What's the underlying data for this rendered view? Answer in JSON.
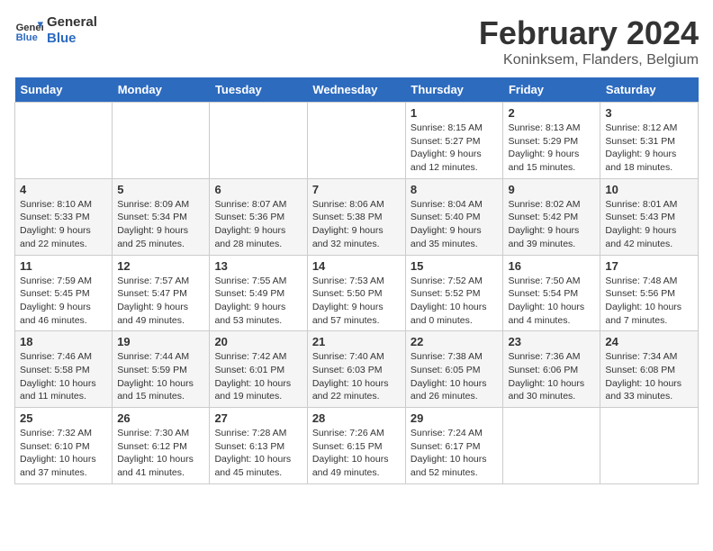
{
  "header": {
    "logo_line1": "General",
    "logo_line2": "Blue",
    "month": "February 2024",
    "location": "Koninksem, Flanders, Belgium"
  },
  "days_of_week": [
    "Sunday",
    "Monday",
    "Tuesday",
    "Wednesday",
    "Thursday",
    "Friday",
    "Saturday"
  ],
  "weeks": [
    [
      {
        "day": "",
        "info": ""
      },
      {
        "day": "",
        "info": ""
      },
      {
        "day": "",
        "info": ""
      },
      {
        "day": "",
        "info": ""
      },
      {
        "day": "1",
        "info": "Sunrise: 8:15 AM\nSunset: 5:27 PM\nDaylight: 9 hours\nand 12 minutes."
      },
      {
        "day": "2",
        "info": "Sunrise: 8:13 AM\nSunset: 5:29 PM\nDaylight: 9 hours\nand 15 minutes."
      },
      {
        "day": "3",
        "info": "Sunrise: 8:12 AM\nSunset: 5:31 PM\nDaylight: 9 hours\nand 18 minutes."
      }
    ],
    [
      {
        "day": "4",
        "info": "Sunrise: 8:10 AM\nSunset: 5:33 PM\nDaylight: 9 hours\nand 22 minutes."
      },
      {
        "day": "5",
        "info": "Sunrise: 8:09 AM\nSunset: 5:34 PM\nDaylight: 9 hours\nand 25 minutes."
      },
      {
        "day": "6",
        "info": "Sunrise: 8:07 AM\nSunset: 5:36 PM\nDaylight: 9 hours\nand 28 minutes."
      },
      {
        "day": "7",
        "info": "Sunrise: 8:06 AM\nSunset: 5:38 PM\nDaylight: 9 hours\nand 32 minutes."
      },
      {
        "day": "8",
        "info": "Sunrise: 8:04 AM\nSunset: 5:40 PM\nDaylight: 9 hours\nand 35 minutes."
      },
      {
        "day": "9",
        "info": "Sunrise: 8:02 AM\nSunset: 5:42 PM\nDaylight: 9 hours\nand 39 minutes."
      },
      {
        "day": "10",
        "info": "Sunrise: 8:01 AM\nSunset: 5:43 PM\nDaylight: 9 hours\nand 42 minutes."
      }
    ],
    [
      {
        "day": "11",
        "info": "Sunrise: 7:59 AM\nSunset: 5:45 PM\nDaylight: 9 hours\nand 46 minutes."
      },
      {
        "day": "12",
        "info": "Sunrise: 7:57 AM\nSunset: 5:47 PM\nDaylight: 9 hours\nand 49 minutes."
      },
      {
        "day": "13",
        "info": "Sunrise: 7:55 AM\nSunset: 5:49 PM\nDaylight: 9 hours\nand 53 minutes."
      },
      {
        "day": "14",
        "info": "Sunrise: 7:53 AM\nSunset: 5:50 PM\nDaylight: 9 hours\nand 57 minutes."
      },
      {
        "day": "15",
        "info": "Sunrise: 7:52 AM\nSunset: 5:52 PM\nDaylight: 10 hours\nand 0 minutes."
      },
      {
        "day": "16",
        "info": "Sunrise: 7:50 AM\nSunset: 5:54 PM\nDaylight: 10 hours\nand 4 minutes."
      },
      {
        "day": "17",
        "info": "Sunrise: 7:48 AM\nSunset: 5:56 PM\nDaylight: 10 hours\nand 7 minutes."
      }
    ],
    [
      {
        "day": "18",
        "info": "Sunrise: 7:46 AM\nSunset: 5:58 PM\nDaylight: 10 hours\nand 11 minutes."
      },
      {
        "day": "19",
        "info": "Sunrise: 7:44 AM\nSunset: 5:59 PM\nDaylight: 10 hours\nand 15 minutes."
      },
      {
        "day": "20",
        "info": "Sunrise: 7:42 AM\nSunset: 6:01 PM\nDaylight: 10 hours\nand 19 minutes."
      },
      {
        "day": "21",
        "info": "Sunrise: 7:40 AM\nSunset: 6:03 PM\nDaylight: 10 hours\nand 22 minutes."
      },
      {
        "day": "22",
        "info": "Sunrise: 7:38 AM\nSunset: 6:05 PM\nDaylight: 10 hours\nand 26 minutes."
      },
      {
        "day": "23",
        "info": "Sunrise: 7:36 AM\nSunset: 6:06 PM\nDaylight: 10 hours\nand 30 minutes."
      },
      {
        "day": "24",
        "info": "Sunrise: 7:34 AM\nSunset: 6:08 PM\nDaylight: 10 hours\nand 33 minutes."
      }
    ],
    [
      {
        "day": "25",
        "info": "Sunrise: 7:32 AM\nSunset: 6:10 PM\nDaylight: 10 hours\nand 37 minutes."
      },
      {
        "day": "26",
        "info": "Sunrise: 7:30 AM\nSunset: 6:12 PM\nDaylight: 10 hours\nand 41 minutes."
      },
      {
        "day": "27",
        "info": "Sunrise: 7:28 AM\nSunset: 6:13 PM\nDaylight: 10 hours\nand 45 minutes."
      },
      {
        "day": "28",
        "info": "Sunrise: 7:26 AM\nSunset: 6:15 PM\nDaylight: 10 hours\nand 49 minutes."
      },
      {
        "day": "29",
        "info": "Sunrise: 7:24 AM\nSunset: 6:17 PM\nDaylight: 10 hours\nand 52 minutes."
      },
      {
        "day": "",
        "info": ""
      },
      {
        "day": "",
        "info": ""
      }
    ]
  ]
}
